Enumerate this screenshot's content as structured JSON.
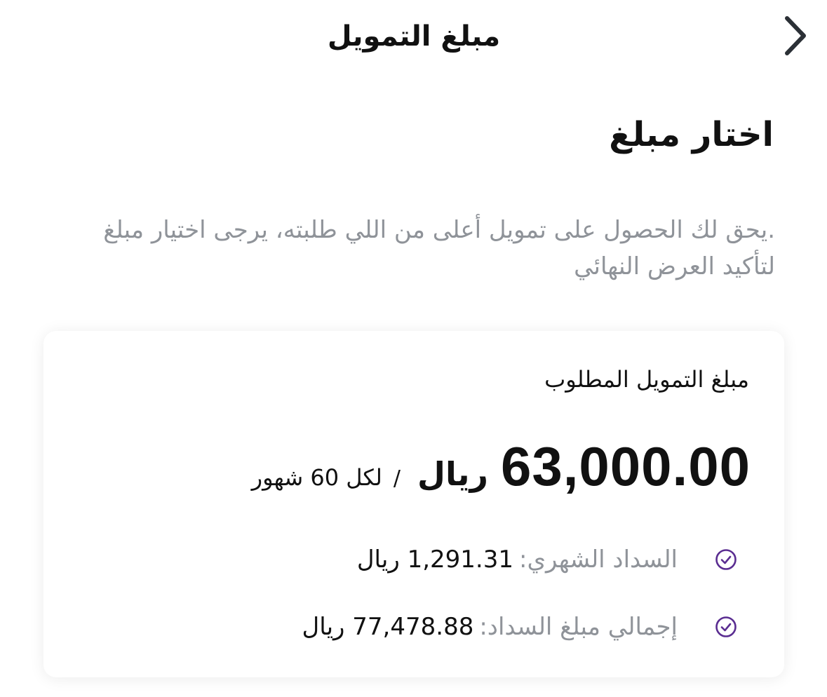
{
  "header": {
    "title": "مبلغ التمويل",
    "back_icon": "chevron-right-icon"
  },
  "main": {
    "title": "اختار مبلغ",
    "description": ".يحق لك الحصول على تمويل أعلى من اللي طلبته، يرجى اختيار مبلغ لتأكيد العرض النهائي"
  },
  "card": {
    "label": "مبلغ التمويل المطلوب",
    "amount": "63,000.00",
    "currency": "ريال",
    "separator": "/",
    "term": "لكل 60 شهور",
    "monthly_payment": {
      "icon": "check-circle-icon",
      "label": "السداد الشهري:",
      "value": "1,291.31 ريال"
    },
    "total_payment": {
      "icon": "check-circle-icon",
      "label": "إجمالي مبلغ السداد:",
      "value": "77,478.88 ريال"
    }
  },
  "colors": {
    "text": "#111111",
    "muted": "#8f9399",
    "accent": "#5a2d91",
    "icon_stroke": "#2b3036"
  }
}
